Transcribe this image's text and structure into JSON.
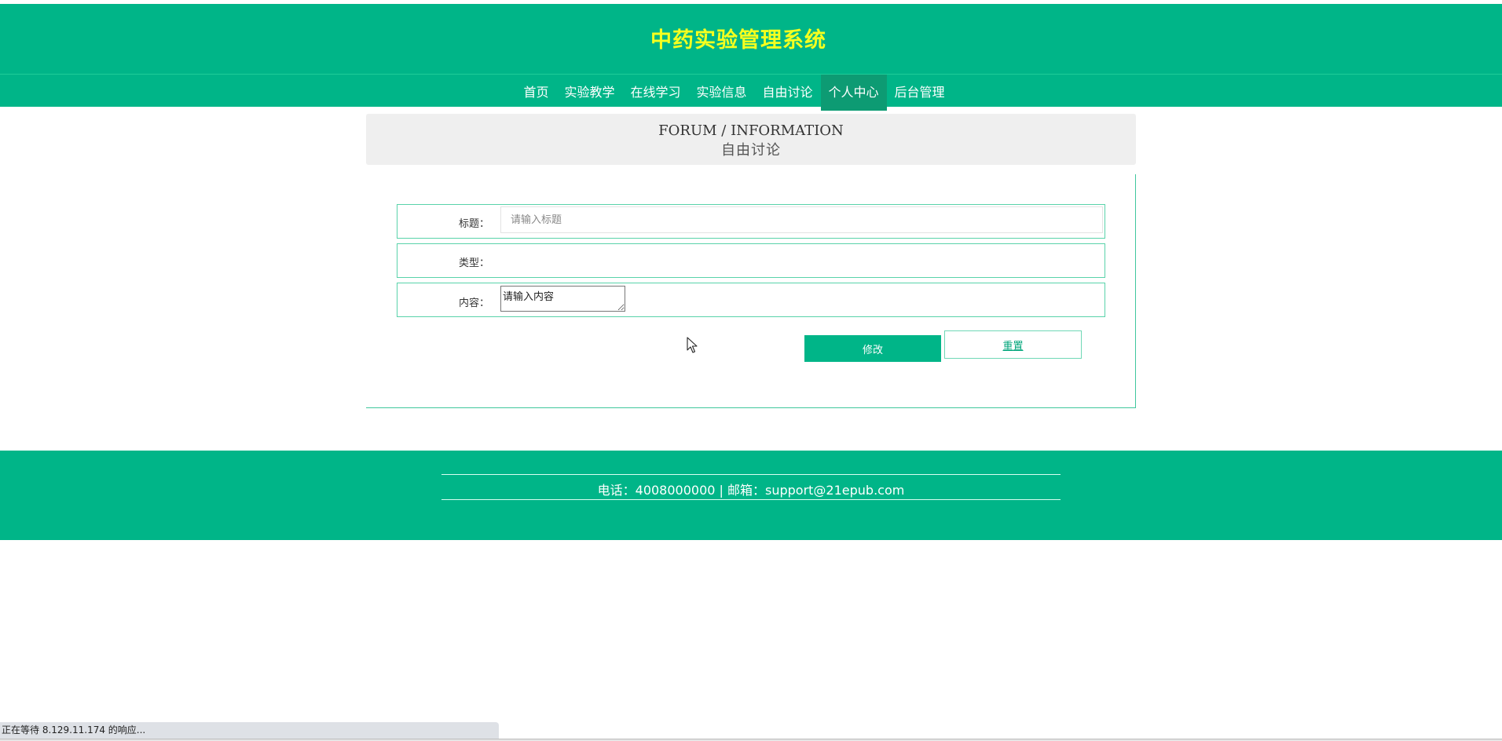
{
  "header": {
    "site_title": "中药实验管理系统"
  },
  "nav": {
    "items": [
      {
        "label": "首页"
      },
      {
        "label": "实验教学"
      },
      {
        "label": "在线学习"
      },
      {
        "label": "实验信息"
      },
      {
        "label": "自由讨论"
      },
      {
        "label": "个人中心",
        "active": true
      },
      {
        "label": "后台管理"
      }
    ]
  },
  "section": {
    "title_en": "FORUM / INFORMATION",
    "title_cn": "自由讨论"
  },
  "form": {
    "title_label": "标题：",
    "title_placeholder": "请输入标题",
    "title_value": "",
    "type_label": "类型：",
    "content_label": "内容：",
    "content_placeholder": "请输入内容",
    "content_value": "",
    "submit_label": "修改",
    "reset_label": "重置"
  },
  "footer": {
    "contact_text": "电话：4008000000 | 邮箱：support@21epub.com"
  },
  "browser": {
    "status_text": "正在等待 8.129.11.174 的响应..."
  },
  "colors": {
    "brand": "#00b588",
    "title": "#f5ff1f",
    "nav_active": "#0d9b73"
  }
}
